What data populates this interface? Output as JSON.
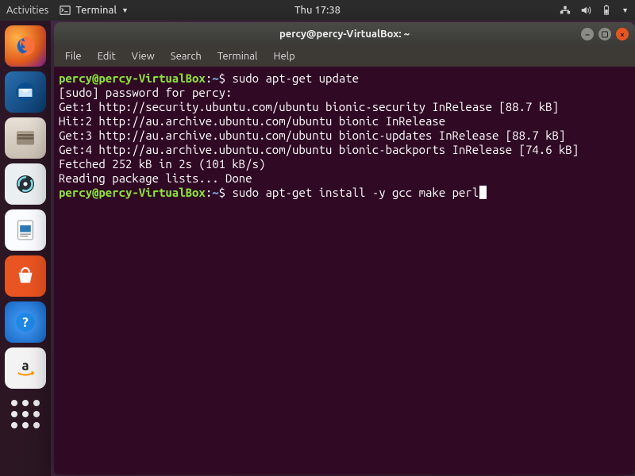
{
  "panel": {
    "activities": "Activities",
    "app_label": "Terminal",
    "clock": "Thu 17:38"
  },
  "launcher": {
    "items": [
      {
        "name": "firefox",
        "label": "Firefox"
      },
      {
        "name": "thunderbird",
        "label": "Thunderbird"
      },
      {
        "name": "files",
        "label": "Files"
      },
      {
        "name": "rhythmbox",
        "label": "Rhythmbox"
      },
      {
        "name": "writer",
        "label": "LibreOffice Writer"
      },
      {
        "name": "software",
        "label": "Ubuntu Software"
      },
      {
        "name": "help",
        "label": "Help"
      },
      {
        "name": "amazon",
        "label": "Amazon"
      }
    ]
  },
  "window": {
    "title": "percy@percy-VirtualBox: ~",
    "menus": [
      "File",
      "Edit",
      "View",
      "Search",
      "Terminal",
      "Help"
    ]
  },
  "terminal": {
    "prompt_user": "percy@percy-VirtualBox",
    "prompt_sep": ":",
    "prompt_path": "~",
    "prompt_sym": "$ ",
    "cmd1": "sudo apt-get update",
    "line_sudo": "[sudo] password for percy:",
    "line_get1": "Get:1 http://security.ubuntu.com/ubuntu bionic-security InRelease [88.7 kB]",
    "line_hit2": "Hit:2 http://au.archive.ubuntu.com/ubuntu bionic InRelease",
    "line_get3": "Get:3 http://au.archive.ubuntu.com/ubuntu bionic-updates InRelease [88.7 kB]",
    "line_get4": "Get:4 http://au.archive.ubuntu.com/ubuntu bionic-backports InRelease [74.6 kB]",
    "line_fetched": "Fetched 252 kB in 2s (101 kB/s)",
    "line_reading": "Reading package lists... Done",
    "cmd2": "sudo apt-get install -y gcc make perl"
  }
}
